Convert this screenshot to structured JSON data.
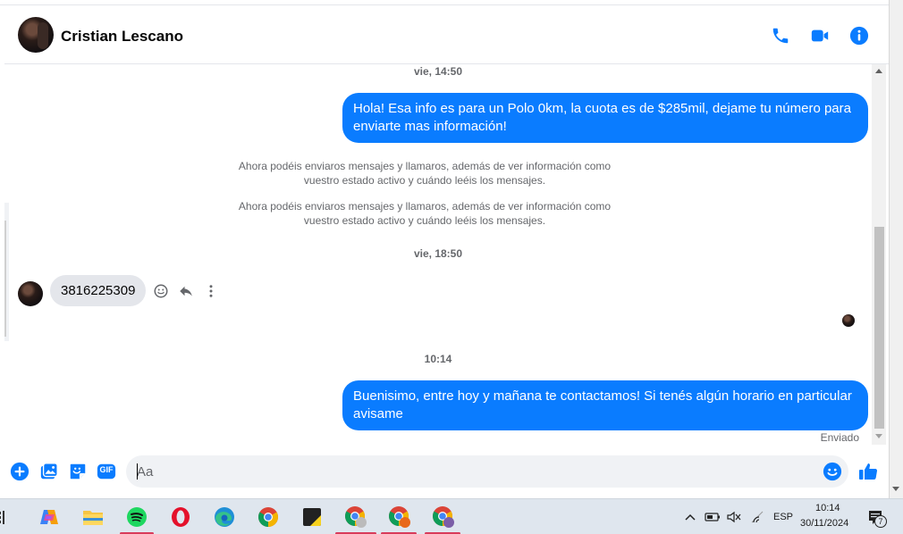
{
  "header": {
    "contact_name": "Cristian Lescano"
  },
  "chat": {
    "timestamps": [
      "vie, 14:50",
      "vie, 18:50",
      "10:14"
    ],
    "outgoing_1": "Hola! Esa info es para un Polo 0km, la cuota es de $285mil, dejame tu número para enviarte mas información!",
    "system_1_line1": "Ahora podéis enviaros mensajes y llamaros, además de ver información como",
    "system_1_line2": "vuestro estado activo y cuándo leéis los mensajes.",
    "system_2_line1": "Ahora podéis enviaros mensajes y llamaros, además de ver información como",
    "system_2_line2": "vuestro estado activo y cuándo leéis los mensajes.",
    "incoming_1": "3816225309",
    "outgoing_2": "Buenisimo, entre hoy y mañana te contactamos! Si tenés algún horario en particular avisame",
    "status": "Enviado"
  },
  "composer": {
    "placeholder": "Aa",
    "gif_label": "GIF"
  },
  "taskbar": {
    "language": "ESP",
    "time": "10:14",
    "date": "30/11/2024",
    "notification_count": "7"
  },
  "colors": {
    "accent": "#0a7cff",
    "incoming_bubble": "#e4e6eb",
    "secondary_text": "#65676b"
  }
}
